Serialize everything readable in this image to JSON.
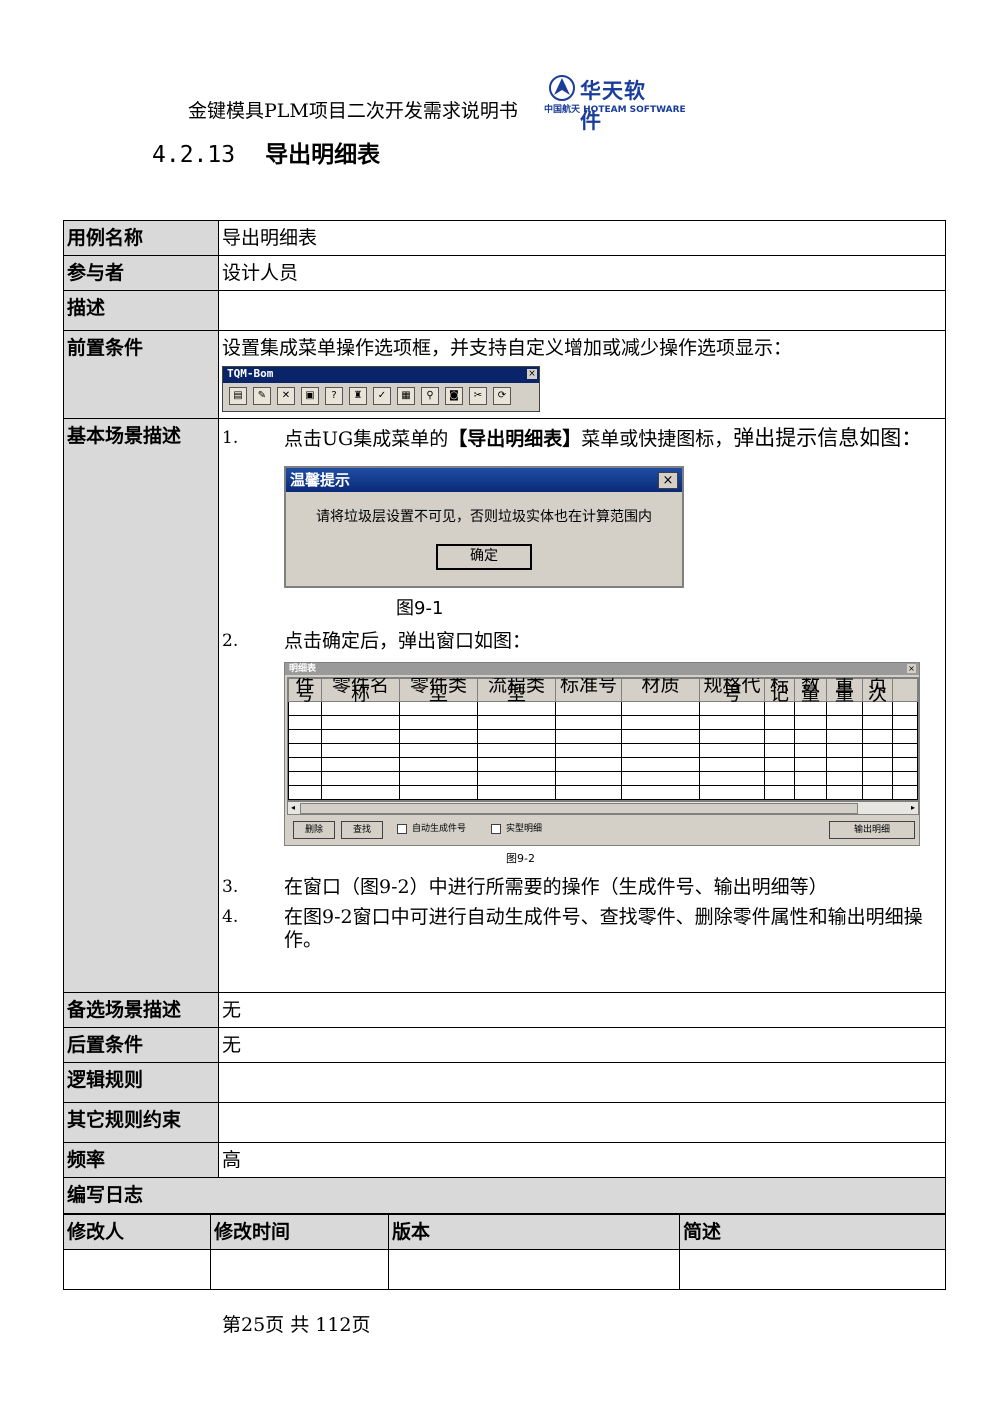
{
  "header": {
    "doc_title": "金键模具PLM项目二次开发需求说明书",
    "logo_brand": "华天软件",
    "logo_sub": "中国航天 HOTEAM SOFTWARE"
  },
  "section": {
    "number": "4.2.13",
    "title": "导出明细表"
  },
  "rows": {
    "usecase_label": "用例名称",
    "usecase_value": "导出明细表",
    "actor_label": "参与者",
    "actor_value": "设计人员",
    "desc_label": "描述",
    "desc_value": "",
    "pre_label": "前置条件",
    "pre_value": "设置集成菜单操作选项框，并支持自定义增加或减少操作选项显示：",
    "basic_label": "基本场景描述",
    "alt_label": "备选场景描述",
    "alt_value": "无",
    "post_label": "后置条件",
    "post_value": "无",
    "logic_label": "逻辑规则",
    "logic_value": "",
    "other_label": "其它规则约束",
    "other_value": "",
    "freq_label": "频率",
    "freq_value": "高",
    "log_label": "编写日志"
  },
  "toolbar": {
    "title": "TQM-Bom",
    "close": "×",
    "icons": [
      "▤",
      "✎",
      "✕",
      "▣",
      "?",
      "♜",
      "✓",
      "▦",
      "⚲",
      "◙",
      "✂",
      "⟳"
    ]
  },
  "steps": {
    "s1_num": "1.",
    "s1_a": "点击UG集成菜单的",
    "s1_b": "【导出明细表】",
    "s1_c": "菜单或快捷图标，",
    "s1_d": "弹出提示信息如图：",
    "s2_num": "2.",
    "s2_text": "点击确定后，弹出窗口如图：",
    "s3_num": "3.",
    "s3_text": "在窗口（图9-2）中进行所需要的操作（生成件号、输出明细等）",
    "s4_num": "4.",
    "s4_text": "在图9-2窗口中可进行自动生成件号、查找零件、删除零件属性和输出明细操作。"
  },
  "dialog": {
    "title": "温馨提示",
    "close": "×",
    "message": "请将垃圾层设置不可见，否则垃圾实体也在计算范围内",
    "ok": "确定",
    "caption": "图9-1"
  },
  "window": {
    "title": "明细表",
    "close": "×",
    "columns": [
      "件号",
      "零件名称",
      "零件类型",
      "流程类型",
      "标准号",
      "材质",
      "规格代号",
      "标记",
      "数量",
      "重量",
      "页次"
    ],
    "btn_delete": "删除",
    "btn_find": "查找",
    "chk_auto": "自动生成件号",
    "chk_solid": "实型明细",
    "btn_output": "输出明细",
    "caption": "图9-2"
  },
  "log_table": {
    "headers": [
      "修改人",
      "修改时间",
      "版本",
      "简述"
    ]
  },
  "footer": {
    "page": "第25页 共 112页"
  }
}
